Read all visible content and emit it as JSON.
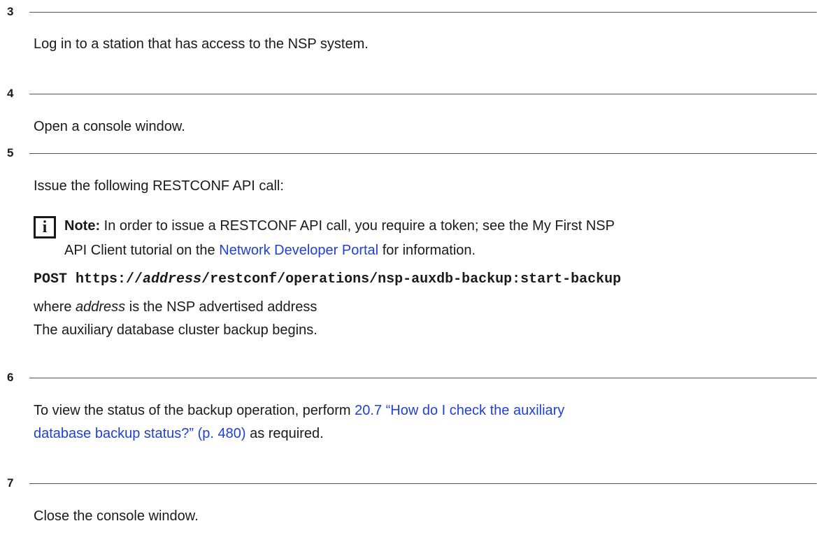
{
  "steps": [
    {
      "number": "3",
      "text": "Log in to a station that has access to the NSP system."
    },
    {
      "number": "4",
      "text": "Open a console window."
    },
    {
      "number": "5",
      "text": "Issue the following RESTCONF API call:",
      "note": {
        "icon": "info-icon",
        "label": "Note:",
        "line1_prefix": "In order to issue a RESTCONF API call, you require a token; see the My First NSP",
        "line2_prefix": "API Client tutorial on the",
        "link_text": "Network Developer Portal",
        "line2_suffix": "for information."
      },
      "command": {
        "method": "POST",
        "url_prefix": "https://",
        "url_variable": "address",
        "url_suffix": "/restconf/operations/nsp-auxdb-backup:start-backup"
      },
      "where_variable": "address",
      "where_text": "is the NSP advertised address",
      "result": "The auxiliary database cluster backup begins."
    },
    {
      "number": "6",
      "text_prefix": "To view the status of the backup operation, perform",
      "link_line1": "20.7 “How do I check the auxiliary",
      "link_line2": "database backup status?” (p. 480)",
      "text_suffix": "as required."
    },
    {
      "number": "7",
      "text": "Close the console window."
    }
  ],
  "colors": {
    "link": "#1f3fd6",
    "text": "#1a1a1a",
    "rule": "#555555"
  }
}
